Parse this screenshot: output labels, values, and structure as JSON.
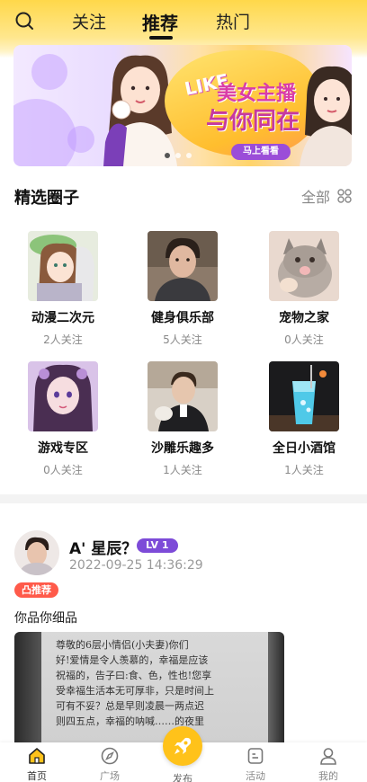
{
  "nav": {
    "tabs": [
      {
        "label": "关注"
      },
      {
        "label": "推荐",
        "active": true
      },
      {
        "label": "热门"
      }
    ]
  },
  "banner": {
    "brand": "LIKE",
    "title_line1": "美女主播",
    "title_line2": "与你同在",
    "cta": "马上看看",
    "page_count": 3,
    "active_page": 1
  },
  "circles_section": {
    "title": "精选圈子",
    "more_label": "全部"
  },
  "circles": [
    {
      "name": "动漫二次元",
      "count": "2人关注"
    },
    {
      "name": "健身俱乐部",
      "count": "5人关注"
    },
    {
      "name": "宠物之家",
      "count": "0人关注"
    },
    {
      "name": "游戏专区",
      "count": "0人关注"
    },
    {
      "name": "沙雕乐趣多",
      "count": "1人关注"
    },
    {
      "name": "全日小酒馆",
      "count": "1人关注"
    }
  ],
  "post": {
    "username": "A' 星辰？",
    "level": "LV 1",
    "time": "2022-09-25 14:36:29",
    "badge": "凸推荐",
    "text": "你品你细品",
    "image_text": "尊敬的6层小情侣(小夫妻)你们\n好!爱情是令人羡慕的，幸福是应该\n祝福的，告子曰:食、色，性也!您享\n受幸福生活本无可厚非，只是时间上\n可有不妥？总是早则凌晨一两点迟\n则四五点，幸福的呐喊……的夜里"
  },
  "bottom_nav": {
    "items": [
      {
        "label": "首页",
        "icon": "home-icon",
        "active": true
      },
      {
        "label": "广场",
        "icon": "compass-icon"
      },
      {
        "label": "发布",
        "icon": "rocket-icon"
      },
      {
        "label": "活动",
        "icon": "activity-icon"
      },
      {
        "label": "我的",
        "icon": "user-icon"
      }
    ]
  },
  "colors": {
    "accent": "#ffc21a",
    "level_badge": "#7d4bd8",
    "recommend_badge": "#ff5a4a"
  }
}
